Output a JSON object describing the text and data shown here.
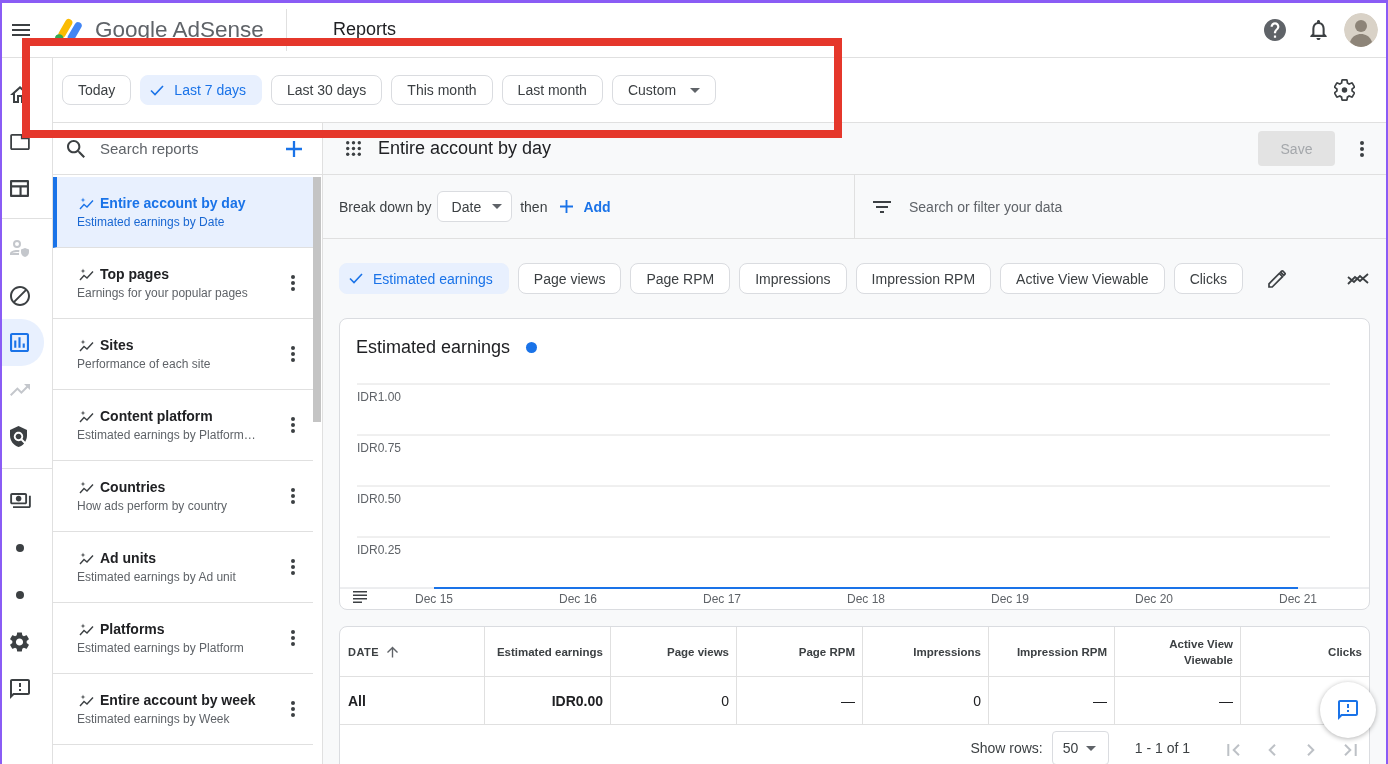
{
  "top_bar": {
    "product_name": "Google AdSense",
    "page_title": "Reports"
  },
  "nav_rail": {
    "groups": [
      [
        {
          "selected": false,
          "dimmed": false
        },
        {
          "selected": false,
          "dimmed": false
        },
        {
          "selected": false,
          "dimmed": false
        }
      ],
      [
        {
          "selected": false,
          "dimmed": true
        },
        {
          "selected": false,
          "dimmed": false
        },
        {
          "selected": true,
          "dimmed": false
        },
        {
          "selected": false,
          "dimmed": true
        },
        {
          "selected": false,
          "dimmed": false
        }
      ],
      [
        {
          "selected": false,
          "dimmed": false
        },
        {
          "selected": false,
          "dimmed": false
        },
        {
          "selected": false,
          "dimmed": false
        },
        {
          "selected": false,
          "dimmed": false
        },
        {
          "selected": false,
          "dimmed": false
        }
      ]
    ]
  },
  "date_range": [
    {
      "label": "Today",
      "selected": false,
      "kind": "chip"
    },
    {
      "label": "Last 7 days",
      "selected": true,
      "kind": "chip"
    },
    {
      "label": "Last 30 days",
      "selected": false,
      "kind": "chip"
    },
    {
      "label": "This month",
      "selected": false,
      "kind": "chip"
    },
    {
      "label": "Last month",
      "selected": false,
      "kind": "chip"
    },
    {
      "label": "Custom",
      "selected": false,
      "kind": "dropdown"
    }
  ],
  "reports_panel": {
    "search": {
      "placeholder": "Search reports"
    },
    "items": [
      {
        "title": "Entire account by day",
        "subtitle": "Estimated earnings by Date",
        "selected": true
      },
      {
        "title": "Top pages",
        "subtitle": "Earnings for your popular pages",
        "selected": false
      },
      {
        "title": "Sites",
        "subtitle": "Performance of each site",
        "selected": false
      },
      {
        "title": "Content platform",
        "subtitle": "Estimated earnings by Platform…",
        "selected": false
      },
      {
        "title": "Countries",
        "subtitle": "How ads perform by country",
        "selected": false
      },
      {
        "title": "Ad units",
        "subtitle": "Estimated earnings by Ad unit",
        "selected": false
      },
      {
        "title": "Platforms",
        "subtitle": "Estimated earnings by Platform",
        "selected": false
      },
      {
        "title": "Entire account by week",
        "subtitle": "Estimated earnings by Week",
        "selected": false
      }
    ]
  },
  "report": {
    "title": "Entire account by day",
    "save_button": {
      "label": "Save",
      "disabled": true
    }
  },
  "breakdown": {
    "label": "Break down by",
    "dimension": "Date",
    "connector": "then",
    "add_label": "Add"
  },
  "filter": {
    "placeholder": "Search or filter your data"
  },
  "metrics": [
    {
      "label": "Estimated earnings",
      "selected": true
    },
    {
      "label": "Page views",
      "selected": false
    },
    {
      "label": "Page RPM",
      "selected": false
    },
    {
      "label": "Impressions",
      "selected": false
    },
    {
      "label": "Impression RPM",
      "selected": false
    },
    {
      "label": "Active View Viewable",
      "selected": false
    },
    {
      "label": "Clicks",
      "selected": false
    }
  ],
  "chart": {
    "legend_label": "Estimated earnings",
    "y_axis_labels": [
      "IDR1.00",
      "IDR0.75",
      "IDR0.50",
      "IDR0.25"
    ],
    "x_axis_labels": [
      "Dec 15",
      "Dec 16",
      "Dec 17",
      "Dec 18",
      "Dec 19",
      "Dec 20",
      "Dec 21"
    ]
  },
  "table": {
    "columns": [
      {
        "label": "DATE",
        "sorted": true
      },
      {
        "label": "Estimated earnings",
        "sorted": false
      },
      {
        "label": "Page views",
        "sorted": false
      },
      {
        "label": "Page RPM",
        "sorted": false
      },
      {
        "label": "Impressions",
        "sorted": false
      },
      {
        "label": "Impression RPM",
        "sorted": false
      },
      {
        "label": "Active View Viewable",
        "sorted": false
      },
      {
        "label": "Clicks",
        "sorted": false
      }
    ],
    "rows": [
      {
        "cells": [
          "All",
          "IDR0.00",
          "0",
          "—",
          "0",
          "—",
          "—"
        ]
      }
    ]
  },
  "pagination": {
    "label": "Show rows:",
    "rows_per_page": "50",
    "range": "1 - 1 of 1",
    "nav_disabled": true
  }
}
